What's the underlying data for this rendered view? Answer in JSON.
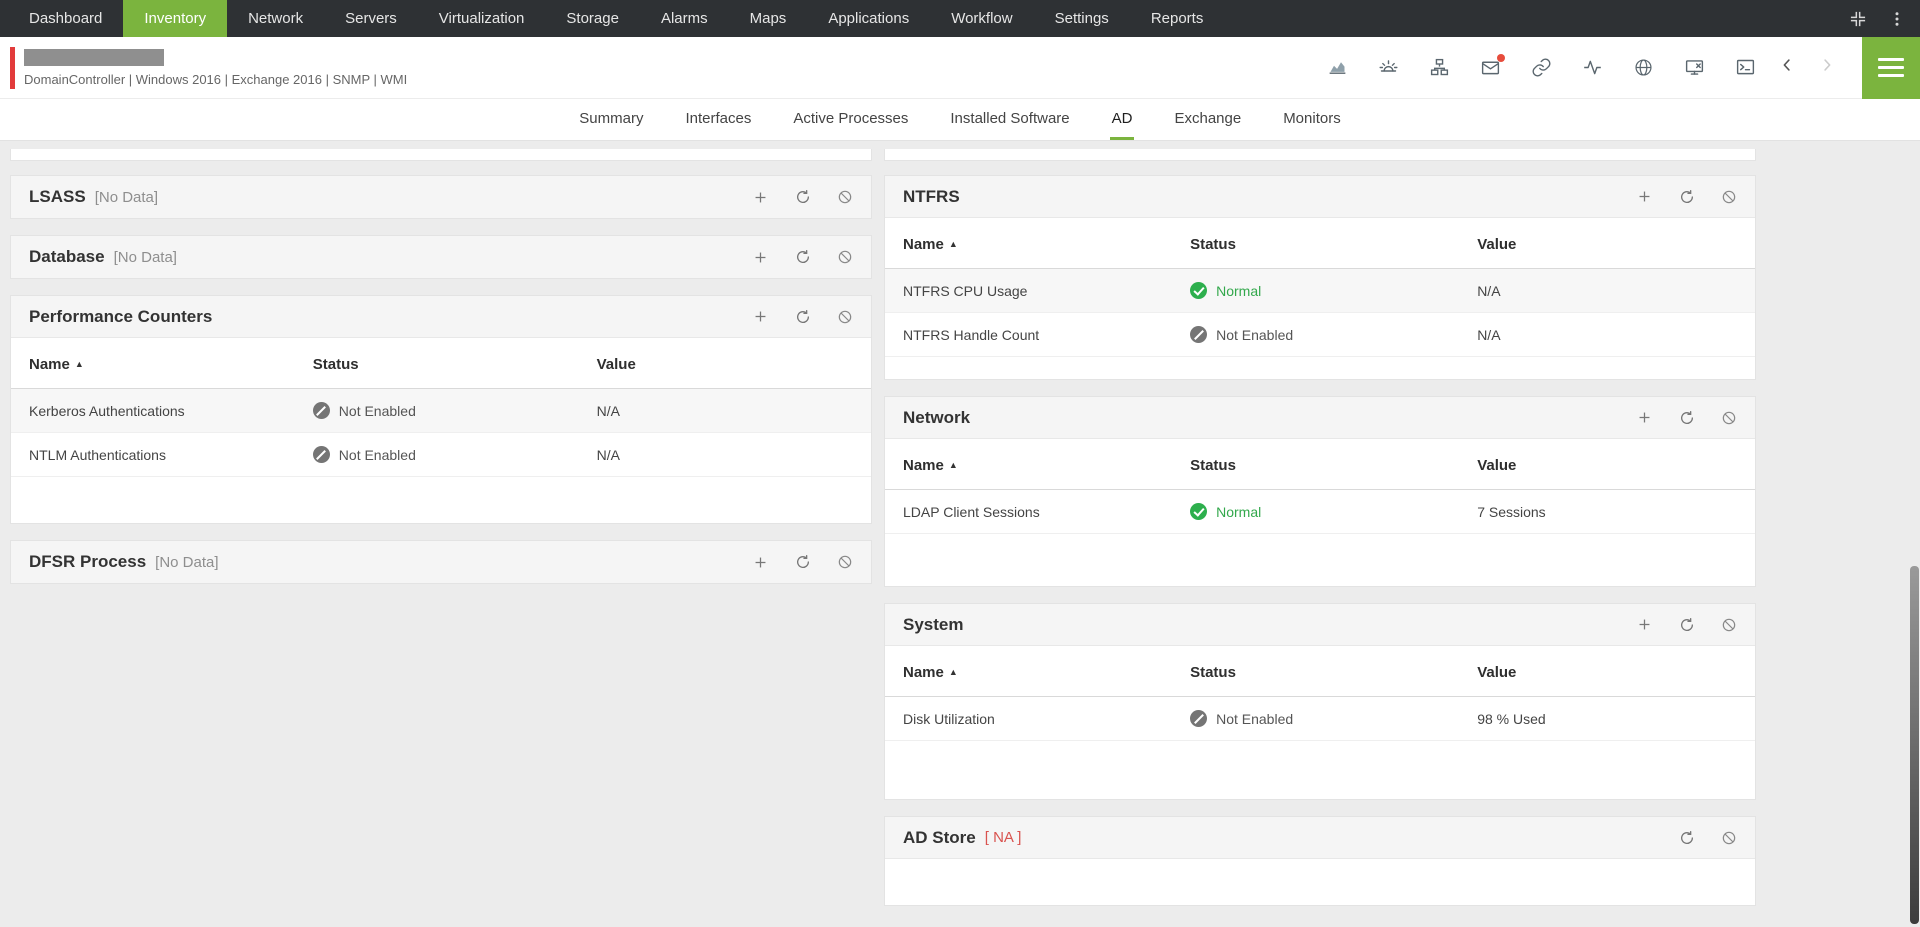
{
  "nav": {
    "items": [
      "Dashboard",
      "Inventory",
      "Network",
      "Servers",
      "Virtualization",
      "Storage",
      "Alarms",
      "Maps",
      "Applications",
      "Workflow",
      "Settings",
      "Reports"
    ],
    "active": "Inventory"
  },
  "device": {
    "meta": "DomainController | Windows 2016  |  Exchange 2016  | SNMP  | WMI"
  },
  "tabs": {
    "items": [
      "Summary",
      "Interfaces",
      "Active Processes",
      "Installed Software",
      "AD",
      "Exchange",
      "Monitors"
    ],
    "active": "AD"
  },
  "icons": {
    "sort_asc": "▲",
    "toolbar": [
      "performance-chart-icon",
      "alarm-icon",
      "workflow-icon",
      "email-icon",
      "link-icon",
      "line-graph-icon",
      "globe-icon",
      "monitor-x-icon",
      "terminal-icon",
      "chevron-left-icon",
      "chevron-right-icon",
      "menu-icon"
    ],
    "panel": [
      "add-icon",
      "refresh-icon",
      "disable-graph-icon"
    ]
  },
  "columns": {
    "name": "Name",
    "status": "Status",
    "value": "Value"
  },
  "panels": {
    "lsass": {
      "title": "LSASS",
      "badge": "[No Data]"
    },
    "database": {
      "title": "Database",
      "badge": "[No Data]"
    },
    "performance_counters": {
      "title": "Performance Counters",
      "rows": [
        {
          "name": "Kerberos Authentications",
          "status": "Not Enabled",
          "value": "N/A"
        },
        {
          "name": "NTLM Authentications",
          "status": "Not Enabled",
          "value": "N/A"
        }
      ]
    },
    "dfsr": {
      "title": "DFSR Process",
      "badge": "[No Data]"
    },
    "ntfrs": {
      "title": "NTFRS",
      "rows": [
        {
          "name": "NTFRS CPU Usage",
          "status": "Normal",
          "value": "N/A"
        },
        {
          "name": "NTFRS Handle Count",
          "status": "Not Enabled",
          "value": "N/A"
        }
      ]
    },
    "network": {
      "title": "Network",
      "rows": [
        {
          "name": "LDAP Client Sessions",
          "status": "Normal",
          "value": "7 Sessions"
        }
      ]
    },
    "system": {
      "title": "System",
      "rows": [
        {
          "name": "Disk Utilization",
          "status": "Not Enabled",
          "value": "98 % Used"
        }
      ]
    },
    "ad_store": {
      "title": "AD Store",
      "badge": "[ NA ]"
    }
  },
  "colors": {
    "brand_green": "#7bb43e",
    "accent_red": "#e23b3b",
    "status_normal_green": "#2daf4d",
    "na_red": "#d9534f",
    "topnav_bg": "#2e3134"
  }
}
